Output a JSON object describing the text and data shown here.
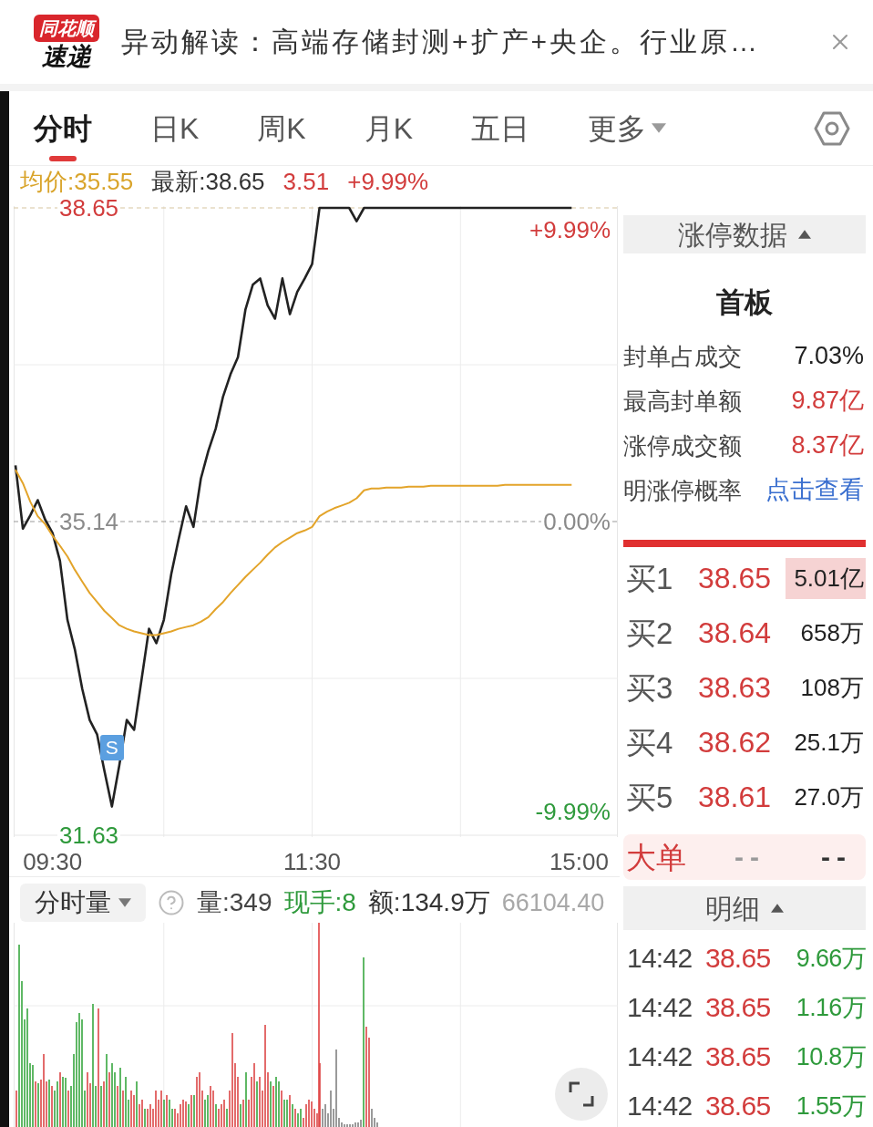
{
  "header": {
    "logo": {
      "badge": "同花顺",
      "text": "速递"
    },
    "title": "异动解读：高端存储封测+扩产+央企。行业原…"
  },
  "tabs": [
    {
      "label": "分时",
      "selected": true,
      "kind": "tab"
    },
    {
      "label": "日K",
      "selected": false,
      "kind": "tab"
    },
    {
      "label": "周K",
      "selected": false,
      "kind": "tab"
    },
    {
      "label": "月K",
      "selected": false,
      "kind": "tab"
    },
    {
      "label": "五日",
      "selected": false,
      "kind": "tab"
    },
    {
      "label": "更多",
      "selected": false,
      "kind": "dropdown"
    }
  ],
  "quote_bar": [
    {
      "text": "均价:35.55",
      "color": "#d9a42b"
    },
    {
      "text": "最新:38.65",
      "color": "#333333"
    },
    {
      "text": "3.51",
      "color": "#d23c3c"
    },
    {
      "text": "+9.99%",
      "color": "#d23c3c"
    }
  ],
  "price_chart": {
    "percent_labels": [
      "+9.99%",
      "0.00%",
      "-9.99%"
    ],
    "signal_marker": "S",
    "chart_data": {
      "type": "line",
      "categories": [
        null,
        null,
        null,
        null,
        null,
        "09:30",
        null,
        null,
        null,
        null,
        null,
        null,
        null,
        null,
        null,
        null,
        null,
        null,
        null,
        null,
        null,
        null,
        null,
        null,
        null,
        null,
        null,
        null,
        null,
        null,
        null,
        null,
        null,
        null,
        null,
        null,
        null,
        null,
        null,
        null,
        "11:30",
        null,
        null,
        null,
        null,
        null,
        null,
        null,
        null,
        null,
        null,
        null,
        null,
        null,
        null,
        null,
        null,
        null,
        null,
        null,
        null,
        null,
        null,
        null,
        null,
        null,
        null,
        null,
        null,
        null,
        null,
        null,
        null,
        null,
        null,
        null,
        "15:00",
        null,
        null,
        null,
        null
      ],
      "series": [
        {
          "color": "#222222",
          "values": [
            35.77,
            35.06,
            35.21,
            35.38,
            35.16,
            35.01,
            34.7,
            34.04,
            33.71,
            33.27,
            32.92,
            32.76,
            32.35,
            31.95,
            32.41,
            32.92,
            32.81,
            33.37,
            33.94,
            33.78,
            34.04,
            34.55,
            34.94,
            35.31,
            35.08,
            35.62,
            35.93,
            36.18,
            36.54,
            36.79,
            36.98,
            37.51,
            37.79,
            37.86,
            37.56,
            37.41,
            37.86,
            37.46,
            37.71,
            37.86,
            38.02,
            38.65,
            38.65,
            38.65,
            38.65,
            38.65,
            38.5,
            38.65,
            38.65,
            38.65,
            38.65,
            38.65,
            38.65,
            38.65,
            38.65,
            38.65,
            38.65,
            38.65,
            38.65,
            38.65,
            38.65,
            38.65,
            38.65,
            38.65,
            38.65,
            38.65,
            38.65,
            38.65,
            38.65,
            38.65,
            38.65,
            38.65,
            38.65,
            38.65,
            38.65,
            38.65,
            null,
            null,
            null,
            null,
            null
          ]
        },
        {
          "color": "#e3a42a",
          "values": [
            35.72,
            35.57,
            35.36,
            35.2,
            35.11,
            34.98,
            34.87,
            34.75,
            34.6,
            34.47,
            34.34,
            34.24,
            34.14,
            34.06,
            33.98,
            33.94,
            33.91,
            33.89,
            33.87,
            33.87,
            33.89,
            33.91,
            33.94,
            33.96,
            33.98,
            34.02,
            34.07,
            34.16,
            34.24,
            34.34,
            34.43,
            34.52,
            34.6,
            34.68,
            34.77,
            34.85,
            34.91,
            34.96,
            35.01,
            35.04,
            35.08,
            35.2,
            35.25,
            35.29,
            35.32,
            35.35,
            35.4,
            35.49,
            35.51,
            35.51,
            35.52,
            35.52,
            35.52,
            35.53,
            35.53,
            35.53,
            35.54,
            35.54,
            35.54,
            35.54,
            35.54,
            35.54,
            35.54,
            35.54,
            35.54,
            35.54,
            35.55,
            35.55,
            35.55,
            35.55,
            35.55,
            35.55,
            35.55,
            35.55,
            35.55,
            35.55,
            null,
            null,
            null,
            null,
            null
          ]
        }
      ],
      "ylim": [
        31.63,
        38.65
      ],
      "yticks": [
        {
          "value": 31.63,
          "label": "31.63"
        },
        {
          "value": 35.14,
          "label": "35.14"
        },
        {
          "value": 38.65,
          "label": "38.65"
        }
      ],
      "ref_lines": [
        {
          "axis": "y",
          "value": 38.65,
          "color": "#d8c6a0"
        },
        {
          "axis": "y",
          "value": 35.14,
          "color": "#9a9a9a"
        }
      ]
    }
  },
  "volume_panel": {
    "selector": {
      "label": "分时量",
      "expanded": false
    },
    "stats": [
      {
        "text": "量:349",
        "color": "#444444"
      },
      {
        "text": "现手:8",
        "color": "#2f9a3c"
      },
      {
        "text": "额:134.9万",
        "color": "#333333"
      }
    ],
    "scale_label": "66104.40"
  },
  "limit_up_panel": {
    "header": {
      "label": "涨停数据",
      "expanded": true
    },
    "board": "首板",
    "rows": [
      {
        "label": "封单占成交",
        "value": "7.03%",
        "color": "#222222"
      },
      {
        "label": "最高封单额",
        "value": "9.87亿",
        "color": "#d23c3c"
      },
      {
        "label": "涨停成交额",
        "value": "8.37亿",
        "color": "#d23c3c"
      }
    ],
    "probability": {
      "label": "明涨停概率",
      "link": "点击查看"
    }
  },
  "order_book": {
    "rows": [
      {
        "label": "买1",
        "price": "38.65",
        "volume": "5.01亿",
        "highlighted": true
      },
      {
        "label": "买2",
        "price": "38.64",
        "volume": "658万",
        "highlighted": false
      },
      {
        "label": "买3",
        "price": "38.63",
        "volume": "108万",
        "highlighted": false
      },
      {
        "label": "买4",
        "price": "38.62",
        "volume": "25.1万",
        "highlighted": false
      },
      {
        "label": "买5",
        "price": "38.61",
        "volume": "27.0万",
        "highlighted": false
      }
    ],
    "big_order": {
      "label": "大单",
      "values": [
        {
          "text": "--",
          "color": "#9a9a9a"
        },
        {
          "text": "--",
          "color": "#333333"
        }
      ]
    }
  },
  "trade_detail": {
    "header": {
      "label": "明细",
      "expanded": true
    },
    "rows": [
      {
        "time": "14:42",
        "price": "38.65",
        "volume": "9.66万"
      },
      {
        "time": "14:42",
        "price": "38.65",
        "volume": "1.16万"
      },
      {
        "time": "14:42",
        "price": "38.65",
        "volume": "10.8万"
      },
      {
        "time": "14:42",
        "price": "38.65",
        "volume": "1.55万"
      }
    ]
  }
}
